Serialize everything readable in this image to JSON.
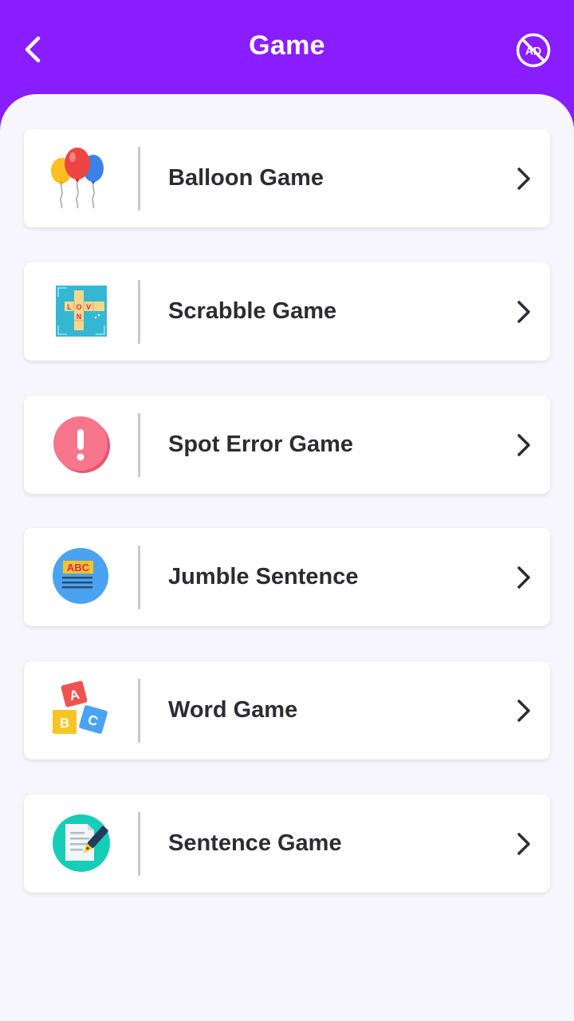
{
  "header": {
    "title": "Game",
    "back_icon": "chevron-left-icon",
    "no_ads_icon": "no-ads-icon",
    "no_ads_text": "AD",
    "background_color": "#8a1dff"
  },
  "games": [
    {
      "label": "Balloon Game",
      "icon": "balloons-icon"
    },
    {
      "label": "Scrabble Game",
      "icon": "scrabble-board-icon",
      "icon_tiles": [
        "L",
        "O",
        "V",
        "N"
      ]
    },
    {
      "label": "Spot Error Game",
      "icon": "exclamation-icon"
    },
    {
      "label": "Jumble Sentence",
      "icon": "abc-text-icon",
      "icon_text": "ABC"
    },
    {
      "label": "Word Game",
      "icon": "alphabet-blocks-icon",
      "icon_letters": [
        "A",
        "B",
        "C"
      ]
    },
    {
      "label": "Sentence Game",
      "icon": "document-pen-icon"
    }
  ],
  "colors": {
    "accent": "#8a1dff",
    "page_background": "#f8f6fd",
    "card_background": "#ffffff",
    "text": "#2c2c33"
  }
}
